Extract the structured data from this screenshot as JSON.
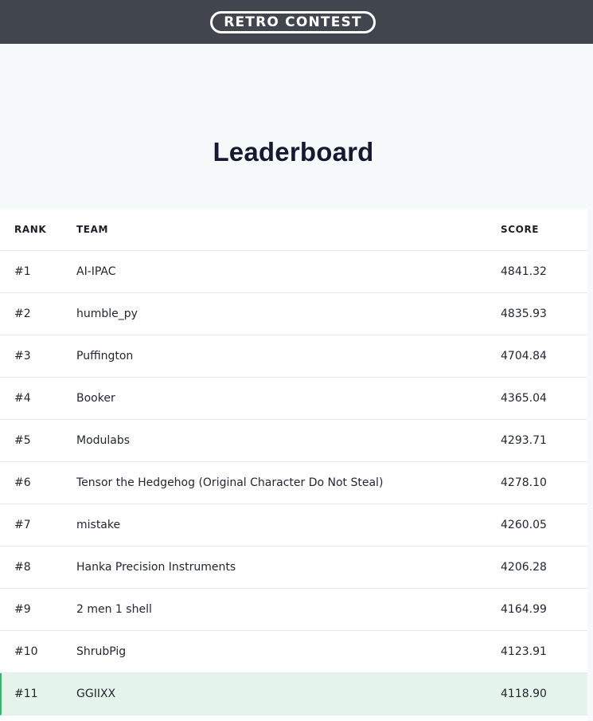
{
  "header": {
    "logo_text": "RETRO CONTEST"
  },
  "page": {
    "title": "Leaderboard"
  },
  "table": {
    "columns": {
      "rank": "RANK",
      "team": "TEAM",
      "score": "SCORE"
    },
    "rows": [
      {
        "rank": "#1",
        "team": "AI-IPAC",
        "score": "4841.32"
      },
      {
        "rank": "#2",
        "team": "humble_py",
        "score": "4835.93"
      },
      {
        "rank": "#3",
        "team": "Puffington",
        "score": "4704.84"
      },
      {
        "rank": "#4",
        "team": "Booker",
        "score": "4365.04"
      },
      {
        "rank": "#5",
        "team": "Modulabs",
        "score": "4293.71"
      },
      {
        "rank": "#6",
        "team": "Tensor the Hedgehog (Original Character Do Not Steal)",
        "score": "4278.10"
      },
      {
        "rank": "#7",
        "team": "mistake",
        "score": "4260.05"
      },
      {
        "rank": "#8",
        "team": "Hanka Precision Instruments",
        "score": "4206.28"
      },
      {
        "rank": "#9",
        "team": "2 men 1 shell",
        "score": "4164.99"
      },
      {
        "rank": "#10",
        "team": "ShrubPig",
        "score": "4123.91"
      },
      {
        "rank": "#11",
        "team": "GGIIXX",
        "score": "4118.90",
        "highlighted": true
      }
    ]
  },
  "colors": {
    "topbar": "#41454d",
    "highlight_row": "#e5f4ea",
    "highlight_accent": "#3bb36a"
  }
}
